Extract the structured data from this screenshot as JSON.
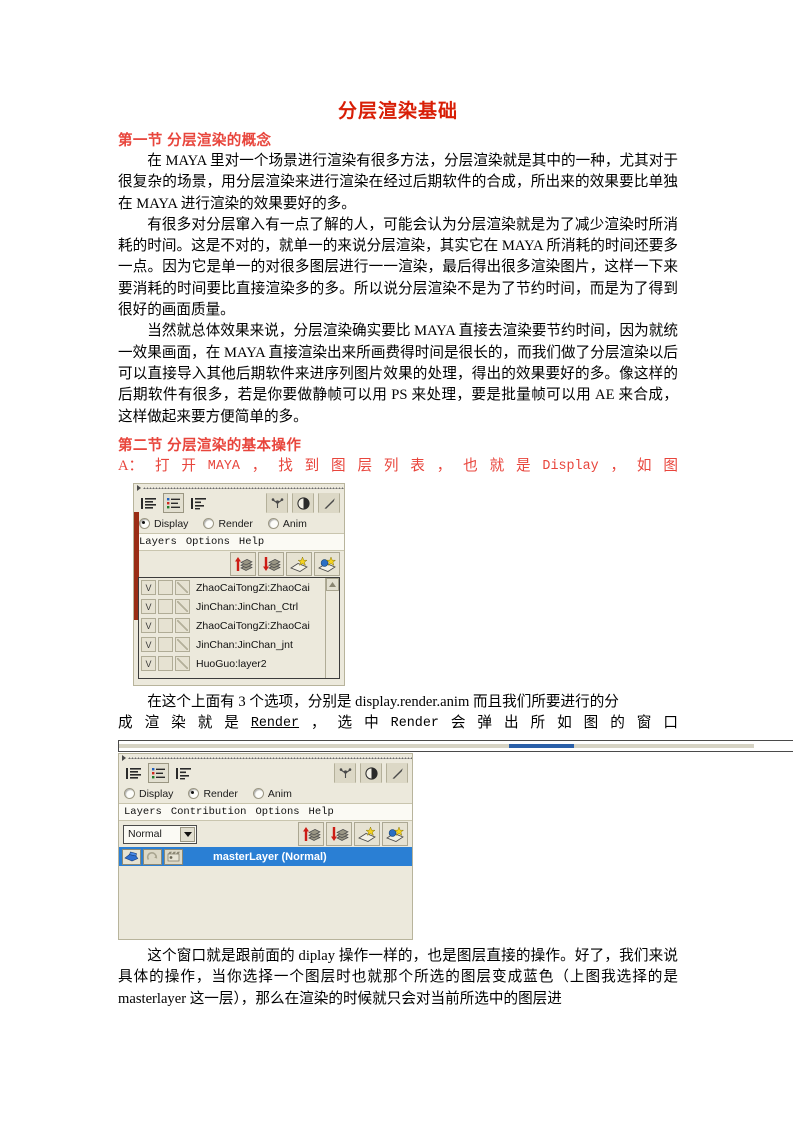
{
  "document": {
    "title": "分层渲染基础",
    "section1_head": "第一节  分层渲染的概念",
    "p1": "在 MAYA 里对一个场景进行渲染有很多方法，分层渲染就是其中的一种，尤其对于很复杂的场景，用分层渲染来进行渲染在经过后期软件的合成，所出来的效果要比单独在 MAYA 进行渲染的效果要好的多。",
    "p2": "有很多对分层窜入有一点了解的人，可能会认为分层渲染就是为了减少渲染时所消耗的时间。这是不对的，就单一的来说分层渲染，其实它在 MAYA 所消耗的时间还要多一点。因为它是单一的对很多图层进行一一渲染，最后得出很多渲染图片，这样一下来要消耗的时间要比直接渲染多的多。所以说分层渲染不是为了节约时间，而是为了得到很好的画面质量。",
    "p3": "当然就总体效果来说，分层渲染确实要比 MAYA 直接去渲染要节约时间，因为就统一效果画面，在 MAYA 直接渲染出来所画费得时间是很长的，而我们做了分层渲染以后可以直接导入其他后期软件来进序列图片效果的处理，得出的效果要好的多。像这样的后期软件有很多，若是你要做静帧可以用 PS 来处理，要是批量帧可以用 AE 来合成，这样做起来要方便简单的多。",
    "section2_head": "第二节  分层渲染的基本操作",
    "step_a_parts": [
      "A：",
      "打",
      "开",
      "MAYA",
      "，",
      "找",
      "到",
      "图",
      "层",
      "列",
      "表",
      "，",
      "也",
      "就",
      "是",
      "Display",
      "，",
      "如",
      "图"
    ],
    "p4_line1": "在这个上面有 3 个选项，分别是 display.render.anim 而且我们所要进行的分",
    "p4_line2_parts": [
      "成",
      "渲",
      "染",
      "就",
      "是",
      "Render",
      "，",
      "选",
      "中",
      "Render",
      "会",
      "弹",
      "出",
      "所",
      "如",
      "图",
      "的",
      "窗",
      "口"
    ],
    "p5": "这个窗口就是跟前面的 diplay 操作一样的，也是图层直接的操作。好了，我们来说具体的操作，当你选择一个图层时也就那个所选的图层变成蓝色（上图我选择的是 masterlayer 这一层），那么在渲染的时候就只会对当前所选中的图层进",
    "colors": {
      "title": "#d81e06",
      "section_head": "#e8453c",
      "selection_blue": "#2a7fd4",
      "panel_bg": "#ece9dc"
    }
  },
  "panel_display": {
    "tabs": [
      {
        "name": "list-view-1-icon"
      },
      {
        "name": "list-view-2-icon"
      },
      {
        "name": "list-view-3-icon"
      }
    ],
    "right_icons": [
      {
        "name": "particle-icon"
      },
      {
        "name": "shading-icon"
      },
      {
        "name": "light-icon"
      }
    ],
    "radios": [
      {
        "label": "Display",
        "selected": true
      },
      {
        "label": "Render",
        "selected": false
      },
      {
        "label": "Anim",
        "selected": false
      }
    ],
    "menus": [
      "Layers",
      "Options",
      "Help"
    ],
    "layer_buttons": [
      {
        "name": "move-layer-up-button"
      },
      {
        "name": "move-layer-down-button"
      },
      {
        "name": "new-layer-button"
      },
      {
        "name": "new-layer-from-selected-button"
      }
    ],
    "layers": [
      {
        "v": "V",
        "name": "ZhaoCaiTongZi:ZhaoCai"
      },
      {
        "v": "V",
        "name": "JinChan:JinChan_Ctrl"
      },
      {
        "v": "V",
        "name": "ZhaoCaiTongZi:ZhaoCai"
      },
      {
        "v": "V",
        "name": "JinChan:JinChan_jnt"
      },
      {
        "v": "V",
        "name": "HuoGuo:layer2"
      }
    ]
  },
  "panel_render": {
    "tabs": [
      {
        "name": "list-view-1-icon"
      },
      {
        "name": "list-view-2-icon"
      },
      {
        "name": "list-view-3-icon"
      }
    ],
    "right_icons": [
      {
        "name": "particle-icon"
      },
      {
        "name": "shading-icon"
      },
      {
        "name": "light-icon"
      }
    ],
    "radios": [
      {
        "label": "Display",
        "selected": false
      },
      {
        "label": "Render",
        "selected": true
      },
      {
        "label": "Anim",
        "selected": false
      }
    ],
    "menus": [
      "Layers",
      "Contribution",
      "Options",
      "Help"
    ],
    "blend_mode": "Normal",
    "layer_buttons": [
      {
        "name": "move-layer-up-button"
      },
      {
        "name": "move-layer-down-button"
      },
      {
        "name": "new-layer-button"
      },
      {
        "name": "new-layer-from-selected-button"
      }
    ],
    "layers": [
      {
        "name": "masterLayer (Normal)",
        "selected": true
      }
    ]
  }
}
